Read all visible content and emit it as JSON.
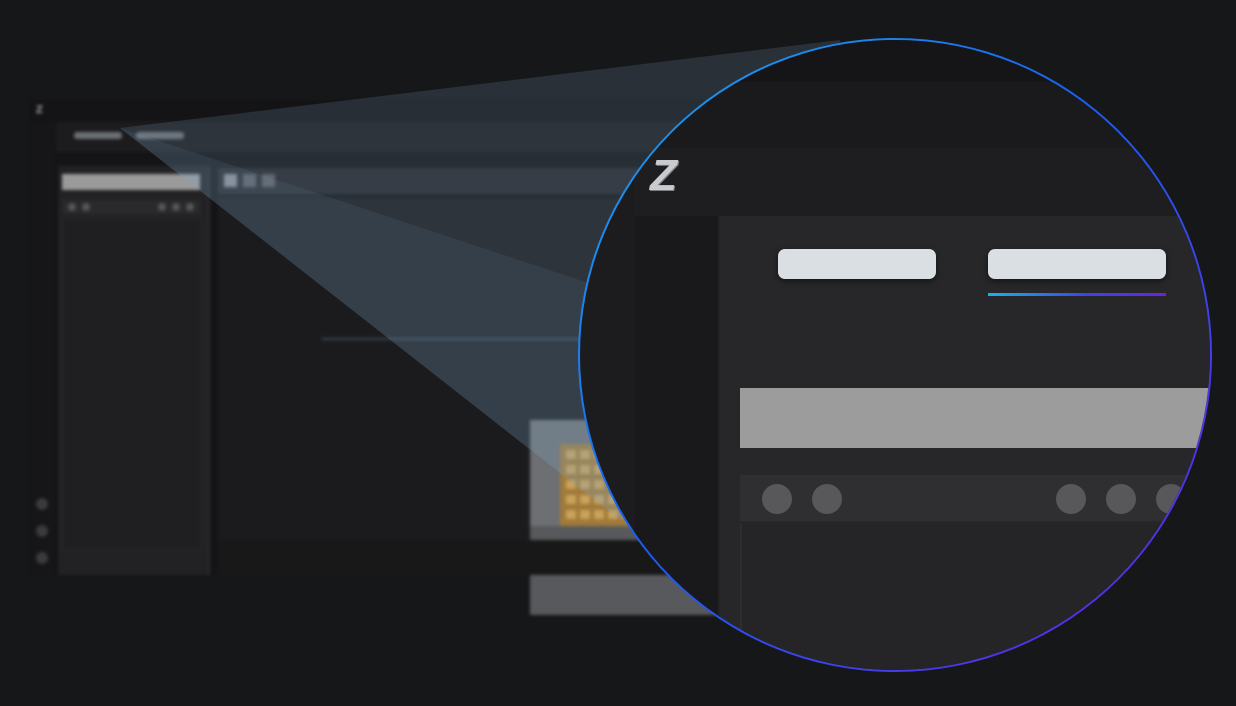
{
  "screen": {
    "description_colors": {
      "background": "#161719",
      "lens_ring_start": "#1ea8ec",
      "lens_ring_end": "#6a1fe8",
      "active_tab_underline": "#3b45e6"
    }
  },
  "background_app": {
    "logo": "Z",
    "rail_icons": [
      "circle-icon",
      "circle-icon",
      "circle-icon"
    ],
    "tabs_count_visible": 2
  },
  "magnifier": {
    "logo": "Z",
    "tabs": [
      {
        "label": "",
        "active": false
      },
      {
        "label": "",
        "active": true
      }
    ],
    "search_placeholder": ""
  }
}
